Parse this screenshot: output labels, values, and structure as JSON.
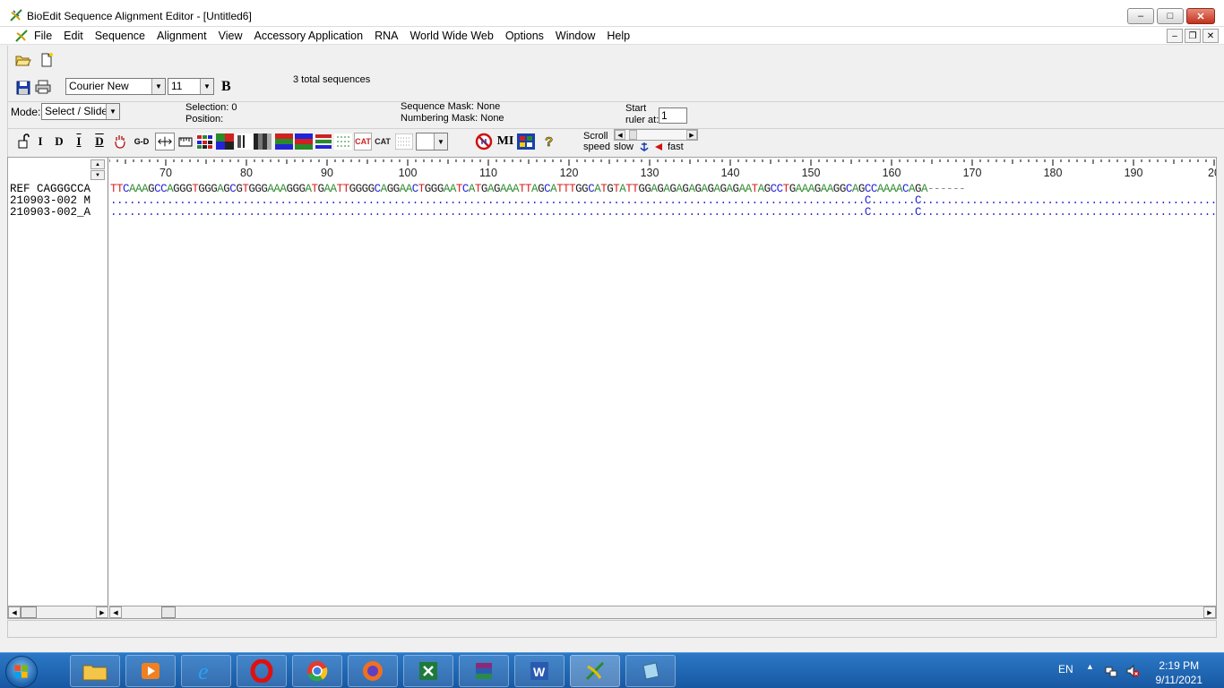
{
  "window": {
    "title": "BioEdit Sequence Alignment Editor - [Untitled6]",
    "minimize": "–",
    "maximize": "□",
    "close": "✕"
  },
  "menu": {
    "items": [
      "File",
      "Edit",
      "Sequence",
      "Alignment",
      "View",
      "Accessory Application",
      "RNA",
      "World Wide Web",
      "Options",
      "Window",
      "Help"
    ],
    "mdi_minimize": "–",
    "mdi_restore": "❐",
    "mdi_close": "✕"
  },
  "toolbar": {
    "font_name": "Courier New",
    "font_size": "11",
    "bold_label": "B",
    "total_sequences": "3 total sequences",
    "mode_label": "Mode:",
    "mode_value": "Select / Slide",
    "selection_label": "Selection: 0",
    "position_label": "Position:",
    "sequence_mask": "Sequence Mask: None",
    "numbering_mask": "Numbering Mask: None",
    "start_label": "Start",
    "ruler_at_label": "ruler at:",
    "ruler_start_value": "1",
    "scroll_label": "Scroll",
    "speed_label": "speed",
    "slow_label": "slow",
    "fast_label": "fast",
    "tool_i": "I",
    "tool_d": "D",
    "tool_i_bar": "I",
    "tool_d_bar": "D",
    "tool_gd": "G-D",
    "tool_mi": "MI",
    "tool_cat1": "CAT",
    "tool_cat2": "CAT"
  },
  "icons": {
    "open": "folder-open-icon",
    "new": "new-document-icon",
    "save": "save-icon",
    "print": "printer-icon",
    "scroll_speed_anchor": "anchor-icon",
    "scroll_speed_flag": "flag-icon",
    "help": "question-icon"
  },
  "ruler": {
    "ticks": [
      "70",
      "80",
      "90",
      "100",
      "110",
      "120",
      "130",
      "140",
      "150",
      "160",
      "170",
      "180",
      "190",
      "20"
    ]
  },
  "sequences": {
    "names": [
      "REF CAGGGCCA",
      "210903-002 M",
      "210903-002_A"
    ],
    "ref": "TTCAAAGCCAGGGTGGGAGCGTGGGAAAGGGATGAATTGGGGCAGGAACTGGGAATCATGAGAAATTAGCATTTGGCATGTATTGGAGAGAGAGAGAGAGAATAGCCTGAAAGAAGGCAGCCAAAACAGA------",
    "seq2": "........................................................................................................................C.......C....................................................................................................................C.GACCAAA",
    "seq3": "........................................................................................................................C.......C.............................................................................................................G......GAA-AAA"
  },
  "taskbar": {
    "language": "EN",
    "time": "2:19 PM",
    "date": "9/11/2021"
  },
  "colors": {
    "A": "#2e8b2e",
    "C": "#2323d8",
    "G": "#222222",
    "T": "#d82020"
  }
}
